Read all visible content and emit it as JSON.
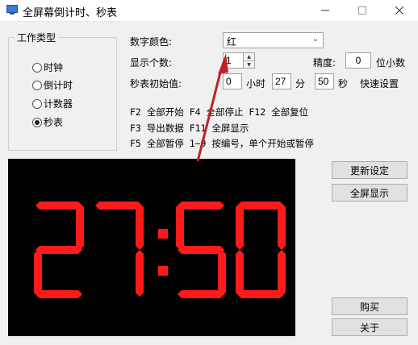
{
  "window": {
    "title": "全屏幕倒计时、秒表",
    "icons": [
      "minimize-icon",
      "maximize-icon",
      "close-icon"
    ]
  },
  "mode_group": {
    "title": "工作类型",
    "options": [
      {
        "label": "时钟",
        "checked": false
      },
      {
        "label": "倒计时",
        "checked": false
      },
      {
        "label": "计数器",
        "checked": false
      },
      {
        "label": "秒表",
        "checked": true
      }
    ]
  },
  "settings": {
    "color_label": "数字颜色:",
    "color_value": "红",
    "digits_label": "显示个数:",
    "digits_value": "1",
    "precision_label": "精度:",
    "precision_value": "0",
    "precision_unit": "位小数",
    "initial_label": "秒表初始值:",
    "hours_value": "0",
    "hours_unit": "小时",
    "minutes_value": "27",
    "minutes_unit": "分",
    "seconds_value": "50",
    "seconds_unit": "秒",
    "quick_setting": "快速设置"
  },
  "hotkeys": [
    "F2 全部开始 F4 全部停止 F12 全部复位",
    "F3 导出数据 F11 全屏显示",
    "F5 全部暂停 1~9 按编号，单个开始或暂停"
  ],
  "buttons": {
    "update": "更新设定",
    "fullscreen": "全屏显示",
    "buy": "购买",
    "about": "关于"
  },
  "display": {
    "time": "27:50",
    "color": "#ff1a1a",
    "background": "#000000"
  },
  "annotation": {
    "arrow_color": "#c0202a"
  }
}
